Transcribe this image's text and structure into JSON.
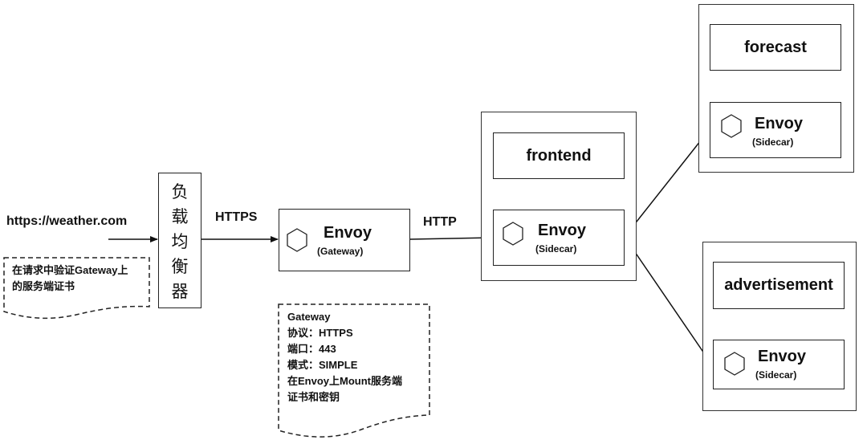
{
  "diagram": {
    "client": {
      "url": "https://weather.com",
      "note": [
        "在请求中验证Gateway上",
        "的服务端证书"
      ]
    },
    "load_balancer": {
      "chars": [
        "负",
        "载",
        "均",
        "衡",
        "器"
      ]
    },
    "edges": {
      "lb_to_gateway": "HTTPS",
      "gateway_to_frontend": "HTTP"
    },
    "gateway": {
      "title": "Envoy",
      "subtitle": "(Gateway)",
      "note": [
        "Gateway",
        "协议：HTTPS",
        "端口：443",
        "模式：SIMPLE",
        "在Envoy上Mount服务端",
        "证书和密钥"
      ]
    },
    "pods": [
      {
        "service": "frontend",
        "sidecar_title": "Envoy",
        "sidecar_subtitle": "(Sidecar)"
      },
      {
        "service": "forecast",
        "sidecar_title": "Envoy",
        "sidecar_subtitle": "(Sidecar)"
      },
      {
        "service": "advertisement",
        "sidecar_title": "Envoy",
        "sidecar_subtitle": "(Sidecar)"
      }
    ],
    "colors": {
      "line": "#222222",
      "background": "#ffffff"
    }
  }
}
